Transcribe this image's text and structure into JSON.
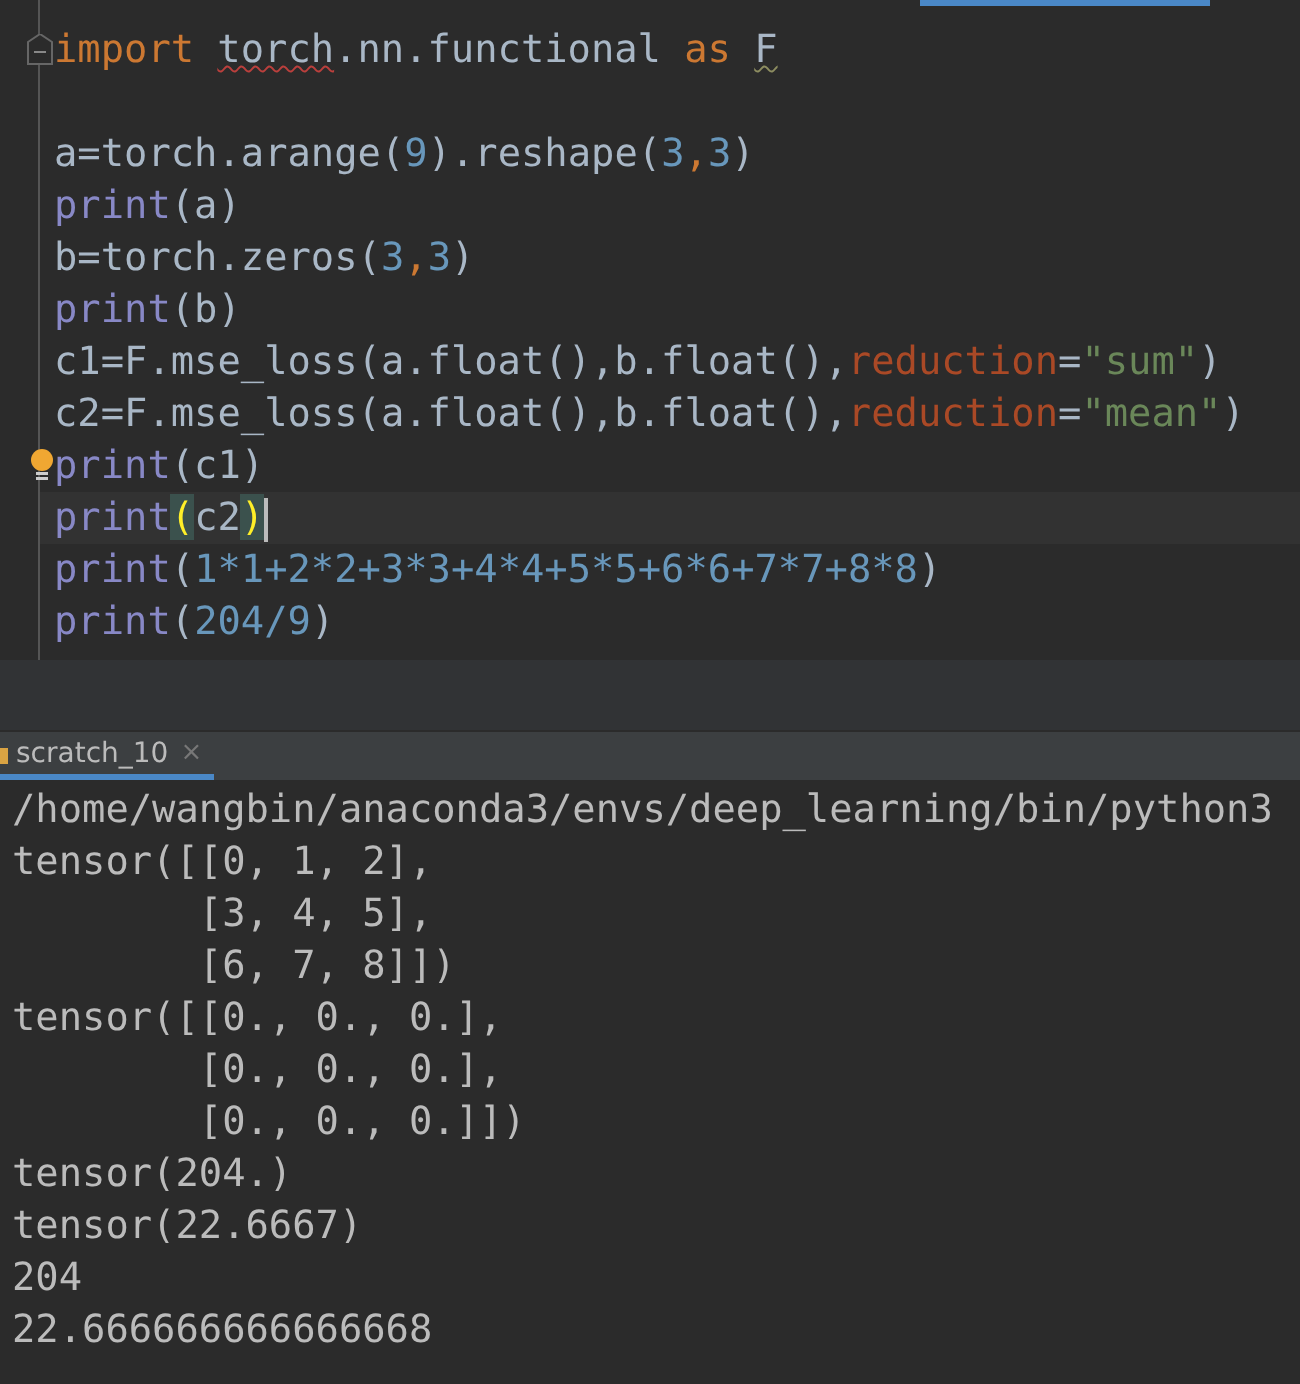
{
  "editor": {
    "lines": [
      {
        "current": false,
        "fold": true,
        "tokens": [
          {
            "kind": "keyword",
            "text": "import",
            "space_after": true
          },
          {
            "kind": "warned",
            "text": "torch"
          },
          {
            "kind": "plain",
            "text": ".nn.functional",
            "space_after": true
          },
          {
            "kind": "keyword",
            "text": "as",
            "space_after": true
          },
          {
            "kind": "weak",
            "text": "F"
          }
        ]
      },
      {
        "current": false
      },
      {
        "current": false,
        "tokens": [
          {
            "kind": "plain",
            "text": "a=torch.arange("
          },
          {
            "kind": "number",
            "text": "9"
          },
          {
            "kind": "plain",
            "text": ").reshape("
          },
          {
            "kind": "number",
            "text": "3"
          },
          {
            "kind": "keyword",
            "text": ","
          },
          {
            "kind": "number",
            "text": "3"
          },
          {
            "kind": "plain",
            "text": ")"
          }
        ]
      },
      {
        "current": false,
        "tokens": [
          {
            "kind": "builtin",
            "text": "print"
          },
          {
            "kind": "plain",
            "text": "(a)"
          }
        ]
      },
      {
        "current": false,
        "tokens": [
          {
            "kind": "plain",
            "text": "b=torch.zeros("
          },
          {
            "kind": "number",
            "text": "3"
          },
          {
            "kind": "keyword",
            "text": ","
          },
          {
            "kind": "number",
            "text": "3"
          },
          {
            "kind": "plain",
            "text": ")"
          }
        ]
      },
      {
        "current": false,
        "tokens": [
          {
            "kind": "builtin",
            "text": "print"
          },
          {
            "kind": "plain",
            "text": "(b)"
          }
        ]
      },
      {
        "current": false,
        "tokens": [
          {
            "kind": "plain",
            "text": "c1=F.mse_loss(a.float(),b.float(),"
          },
          {
            "kind": "param",
            "text": "reduction"
          },
          {
            "kind": "plain",
            "text": "="
          },
          {
            "kind": "string",
            "text": "\"sum\""
          },
          {
            "kind": "plain",
            "text": ")"
          }
        ]
      },
      {
        "current": false,
        "tokens": [
          {
            "kind": "plain",
            "text": "c2=F.mse_loss(a.float(),b.float(),"
          },
          {
            "kind": "param",
            "text": "reduction"
          },
          {
            "kind": "plain",
            "text": "="
          },
          {
            "kind": "string",
            "text": "\"mean\""
          },
          {
            "kind": "plain",
            "text": ")"
          }
        ]
      },
      {
        "current": false,
        "bulb": true,
        "tokens": [
          {
            "kind": "builtin",
            "text": "print"
          },
          {
            "kind": "plain",
            "text": "(c1)"
          }
        ]
      },
      {
        "current": true,
        "tokens": [
          {
            "kind": "builtin",
            "text": "print"
          },
          {
            "kind": "brace",
            "text": "("
          },
          {
            "kind": "plain",
            "text": "c2"
          },
          {
            "kind": "brace",
            "text": ")"
          }
        ]
      },
      {
        "current": false,
        "tokens": [
          {
            "kind": "builtin",
            "text": "print"
          },
          {
            "kind": "plain",
            "text": "("
          },
          {
            "kind": "number",
            "text": "1*1+2*2+3*3+4*4+5*5+6*6+7*7+8*8"
          },
          {
            "kind": "plain",
            "text": ")"
          }
        ]
      },
      {
        "current": false,
        "tokens": [
          {
            "kind": "builtin",
            "text": "print"
          },
          {
            "kind": "plain",
            "text": "("
          },
          {
            "kind": "number",
            "text": "204/9"
          },
          {
            "kind": "plain",
            "text": ")"
          }
        ]
      }
    ]
  },
  "run_tabs": [
    {
      "label": "scratch_10",
      "close": "×",
      "selected": true
    }
  ],
  "console": [
    "/home/wangbin/anaconda3/envs/deep_learning/bin/python3",
    "tensor([[0, 1, 2],",
    "        [3, 4, 5],",
    "        [6, 7, 8]])",
    "tensor([[0., 0., 0.],",
    "        [0., 0., 0.],",
    "        [0., 0., 0.]])",
    "tensor(204.)",
    "tensor(22.6667)",
    "204",
    "22.666666666666668"
  ]
}
